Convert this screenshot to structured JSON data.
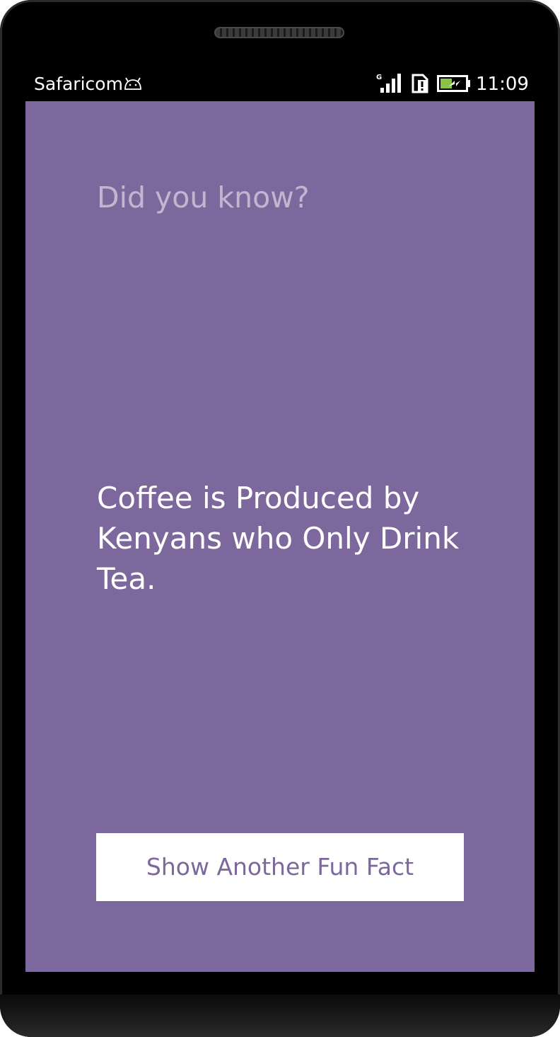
{
  "status_bar": {
    "carrier": "Safaricom",
    "network_type": "G",
    "time": "11:09",
    "icons": {
      "debug": "android-icon",
      "signal": "signal-icon",
      "sim": "sim-alert-icon",
      "battery": "battery-charging-icon"
    }
  },
  "main": {
    "label": "Did you know?",
    "fact": "Coffee is Produced by Kenyans who Only Drink Tea.",
    "button_label": "Show Another Fun Fact"
  },
  "colors": {
    "background": "#7d689e",
    "button_background": "#ffffff",
    "button_text": "#7d689e",
    "battery_charge": "#8bc34a"
  }
}
